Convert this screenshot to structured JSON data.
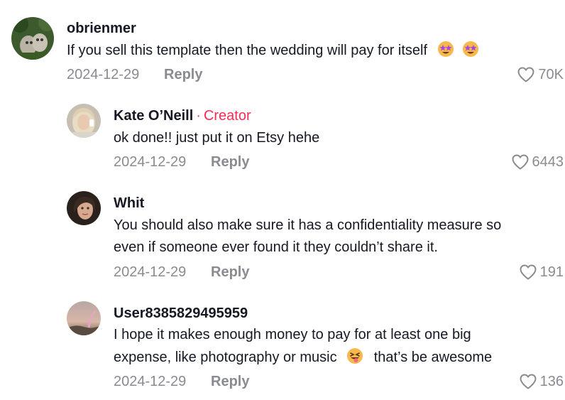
{
  "comments": [
    {
      "username": "obrienmer",
      "text": "If you sell this template then the wedding will pay for itself",
      "emojis": [
        "star-struck-emoji",
        "star-struck-emoji"
      ],
      "date": "2024-12-29",
      "reply_label": "Reply",
      "likes": "70K"
    },
    {
      "username": "Kate O’Neill",
      "creator_dot": "·",
      "creator_label": "Creator",
      "text": "ok done!! just put it on Etsy hehe",
      "date": "2024-12-29",
      "reply_label": "Reply",
      "likes": "6443"
    },
    {
      "username": "Whit",
      "text_lines": [
        "You should also make sure it has a confidentiality measure so",
        "even if someone ever found it they couldn’t share it."
      ],
      "date": "2024-12-29",
      "reply_label": "Reply",
      "likes": "191"
    },
    {
      "username": "User8385829495959",
      "text_line1": "I hope it makes enough money to pay for at least one big",
      "text_line2_before": "expense, like photography or music",
      "emoji": "squinting-tongue-emoji",
      "text_line2_after": "that’s be awesome",
      "date": "2024-12-29",
      "reply_label": "Reply",
      "likes": "136"
    }
  ],
  "colors": {
    "text": "#161823",
    "muted": "#8a8b91",
    "creator": "#fe2c55"
  }
}
